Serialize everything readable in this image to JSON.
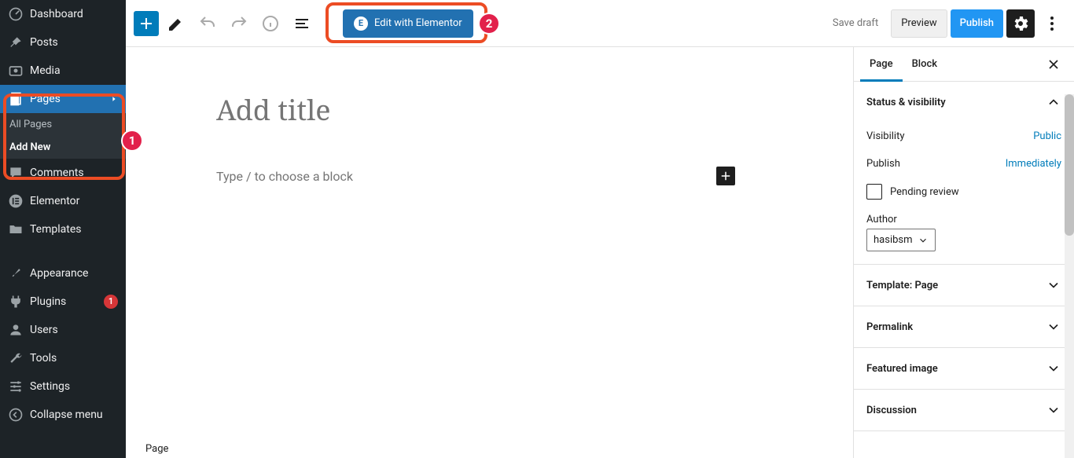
{
  "sidebar": {
    "items": [
      {
        "label": "Dashboard",
        "icon": "dashboard"
      },
      {
        "label": "Posts",
        "icon": "pin"
      },
      {
        "label": "Media",
        "icon": "media"
      },
      {
        "label": "Pages",
        "icon": "page",
        "active": true,
        "sub": [
          {
            "label": "All Pages"
          },
          {
            "label": "Add New",
            "current": true
          }
        ]
      },
      {
        "label": "Comments",
        "icon": "comment"
      },
      {
        "label": "Elementor",
        "icon": "elementor"
      },
      {
        "label": "Templates",
        "icon": "folder"
      },
      {
        "label": "Appearance",
        "icon": "brush"
      },
      {
        "label": "Plugins",
        "icon": "plug",
        "count": "1"
      },
      {
        "label": "Users",
        "icon": "user"
      },
      {
        "label": "Tools",
        "icon": "wrench"
      },
      {
        "label": "Settings",
        "icon": "sliders"
      },
      {
        "label": "Collapse menu",
        "icon": "collapse"
      }
    ]
  },
  "toolbar": {
    "elementor_label": "Edit with Elementor",
    "save_draft": "Save draft",
    "preview": "Preview",
    "publish": "Publish"
  },
  "canvas": {
    "title_placeholder": "Add title",
    "block_prompt": "Type / to choose a block",
    "word_label": "Page"
  },
  "panel": {
    "tabs": {
      "page": "Page",
      "block": "Block"
    },
    "status": {
      "title": "Status & visibility",
      "visibility_label": "Visibility",
      "visibility_value": "Public",
      "publish_label": "Publish",
      "publish_value": "Immediately",
      "pending_label": "Pending review",
      "author_label": "Author",
      "author_value": "hasibsm"
    },
    "sections": {
      "template": "Template: Page",
      "permalink": "Permalink",
      "featured": "Featured image",
      "discussion": "Discussion"
    }
  },
  "callouts": {
    "one": "1",
    "two": "2"
  }
}
